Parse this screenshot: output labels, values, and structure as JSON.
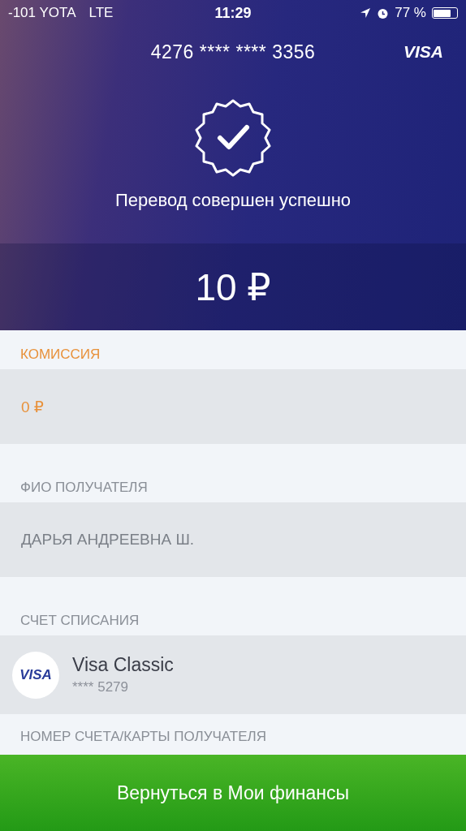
{
  "status_bar": {
    "carrier": "-101 YOTA",
    "network": "LTE",
    "time": "11:29",
    "battery_text": "77 %"
  },
  "card": {
    "number": "4276 **** **** 3356",
    "brand": "VISA"
  },
  "result": {
    "message": "Перевод совершен успешно",
    "amount": "10 ₽"
  },
  "sections": [
    {
      "kind": "text",
      "header": "КОМИССИЯ",
      "accent": true,
      "value": "0 ₽"
    },
    {
      "kind": "text",
      "header": "ФИО ПОЛУЧАТЕЛЯ",
      "accent": false,
      "value": "ДАРЬЯ АНДРЕЕВНА Ш."
    },
    {
      "kind": "account",
      "header": "СЧЕТ СПИСАНИЯ",
      "accent": false,
      "logo": "VISA",
      "title": "Visa Classic",
      "number": "**** 5279"
    },
    {
      "kind": "cut",
      "header": "НОМЕР СЧЕТА/КАРТЫ ПОЛУЧАТЕЛЯ",
      "accent": false
    }
  ],
  "button": {
    "label": "Вернуться в Мои финансы"
  }
}
